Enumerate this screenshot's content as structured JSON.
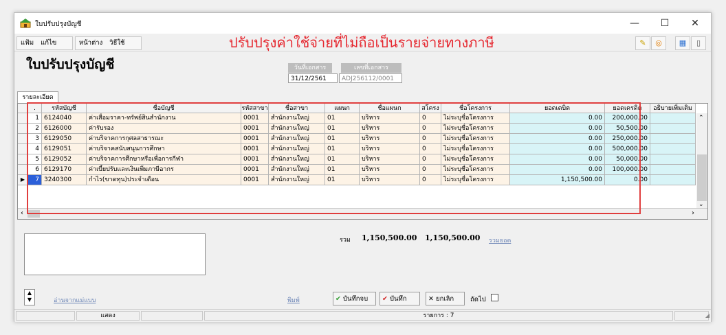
{
  "window": {
    "title": "ใบปรับปรุงบัญชี",
    "minimize": "—",
    "maximize": "☐",
    "close": "✕"
  },
  "menu": {
    "file": "แฟ้ม",
    "edit": "แก้ไข",
    "window": "หน้าต่าง",
    "help": "วิธีใช้"
  },
  "banner": "ปรับปรุงค่าใช้จ่ายที่ไม่ถือเป็นรายจ่ายทางภาษี",
  "page_title": "ใบปรับปรุงบัญชี",
  "doc": {
    "date_label": "วันที่เอกสาร",
    "date_value": "31/12/2561",
    "no_label": "เลขที่เอกสาร",
    "no_value": "ADJ256112/0001"
  },
  "tab_detail": "รายละเอียด",
  "grid": {
    "headers": [
      ".",
      "รหัสบัญชี",
      "ชื่อบัญชี",
      "รหัสสาขา",
      "ชื่อสาขา",
      "แผนก",
      "ชื่อแผนก",
      "สโครง",
      "ชื่อโครงการ",
      "ยอดเดบิต",
      "ยอดเครดิต",
      "อธิบายเพิ่มเติม"
    ],
    "rows": [
      [
        "1",
        "6124040",
        "ค่าเสื่อมราคา-ทรัพย์สินสำนักงาน",
        "0001",
        "สำนักงานใหญ่",
        "01",
        "บริหาร",
        "0",
        "ไม่ระบุชื่อโครงการ",
        "0.00",
        "200,000.00",
        ""
      ],
      [
        "2",
        "6126000",
        "ค่ารับรอง",
        "0001",
        "สำนักงานใหญ่",
        "01",
        "บริหาร",
        "0",
        "ไม่ระบุชื่อโครงการ",
        "0.00",
        "50,500.00",
        ""
      ],
      [
        "3",
        "6129050",
        "ค่าบริจาคการกุศลสาธารณะ",
        "0001",
        "สำนักงานใหญ่",
        "01",
        "บริหาร",
        "0",
        "ไม่ระบุชื่อโครงการ",
        "0.00",
        "250,000.00",
        ""
      ],
      [
        "4",
        "6129051",
        "ค่าบริจาคสนับสนุนการศึกษา",
        "0001",
        "สำนักงานใหญ่",
        "01",
        "บริหาร",
        "0",
        "ไม่ระบุชื่อโครงการ",
        "0.00",
        "500,000.00",
        ""
      ],
      [
        "5",
        "6129052",
        "ค่าบริจาคการศึกษาหรือเพื่อการกีฬา",
        "0001",
        "สำนักงานใหญ่",
        "01",
        "บริหาร",
        "0",
        "ไม่ระบุชื่อโครงการ",
        "0.00",
        "50,000.00",
        ""
      ],
      [
        "6",
        "6129170",
        "ค่าเบี้ยปรับและเงินเพิ่มภาษีอากร",
        "0001",
        "สำนักงานใหญ่",
        "01",
        "บริหาร",
        "0",
        "ไม่ระบุชื่อโครงการ",
        "0.00",
        "100,000.00",
        ""
      ],
      [
        "7",
        "3240300",
        "กำไร(ขาดทุน)ประจำเดือน",
        "0001",
        "สำนักงานใหญ่",
        "01",
        "บริหาร",
        "0",
        "ไม่ระบุชื่อโครงการ",
        "1,150,500.00",
        "0.00",
        ""
      ]
    ]
  },
  "totals": {
    "label": "รวม",
    "debit": "1,150,500.00",
    "credit": "1,150,500.00",
    "sum_link": "รวมยอด"
  },
  "links": {
    "load_template": "อ่านจากแม่แบบ",
    "print": "พิมพ์"
  },
  "buttons": {
    "save_close": "บันทึกจบ",
    "save": "บันทึก",
    "cancel": "ยกเลิก",
    "next": "ถัดไป"
  },
  "status": {
    "show": "แสดง",
    "count": "รายการ : 7"
  },
  "colors": {
    "debit_bg": "#d8f4f7",
    "row_bg": "#fdf3e6",
    "accent": "#e03e3e"
  }
}
